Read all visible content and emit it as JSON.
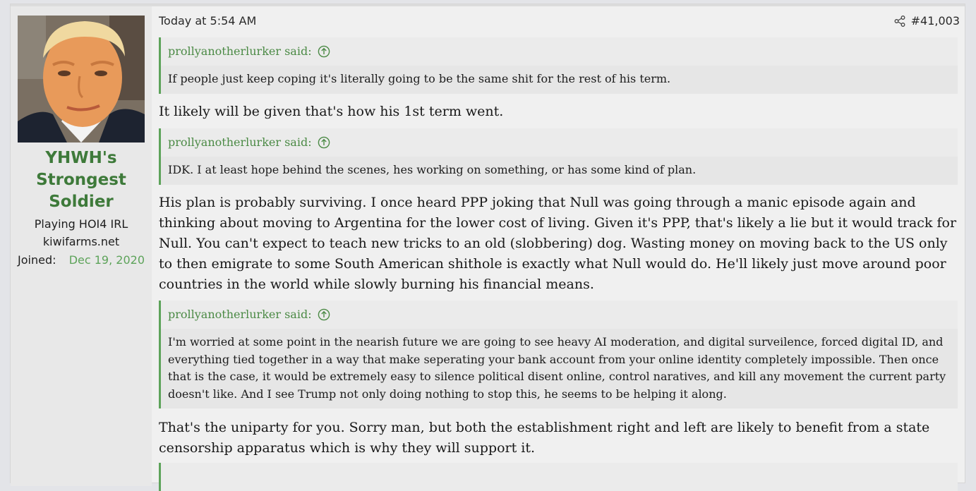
{
  "user": {
    "username_lines": [
      "YHWH's",
      "Strongest",
      "Soldier"
    ],
    "title": "Playing HOI4 IRL",
    "banner": "kiwifarms.net",
    "joined_label": "Joined:",
    "joined_date": "Dec 19, 2020"
  },
  "post": {
    "time": "Today at 5:54 AM",
    "number": "#41,003",
    "share_icon": "share-icon",
    "quotes": [
      {
        "author": "prollyanotherlurker said:",
        "text": "If people just keep coping it's literally going to be the same shit for the rest of his term."
      },
      {
        "author": "prollyanotherlurker said:",
        "text": "IDK. I at least hope behind the scenes, hes working on something, or has some kind of plan."
      },
      {
        "author": "prollyanotherlurker said:",
        "text": "I'm worried at some point in the nearish future we are going to see heavy AI moderation, and digital surveilence, forced digital ID, and everything tied together in a way that make seperating your bank account from your online identity completely impossible. Then once that is the case, it would be extremely easy to silence political disent online, control naratives, and kill any movement the current party doesn't like. And I see Trump not only doing nothing to stop this, he seems to be helping it along."
      }
    ],
    "replies": [
      "It likely will be given that's how his 1st term went.",
      "His plan is probably surviving. I once heard PPP joking that Null was going through a manic episode again and thinking about moving to Argentina for the lower cost of living. Given it's PPP, that's likely a lie but it would track for Null. You can't expect to teach new tricks to an old (slobbering) dog. Wasting money on moving back to the US only to then emigrate to some South American shithole is exactly what Null would do. He'll likely just move around poor countries in the world while slowly burning his financial means.",
      "That's the uniparty for you. Sorry man, but both the establishment right and left are likely to benefit from a state censorship apparatus which is why they will support it."
    ]
  },
  "colors": {
    "accent_green": "#5da35a",
    "username_green": "#3e7a3a",
    "quote_author_green": "#4b8a45"
  }
}
